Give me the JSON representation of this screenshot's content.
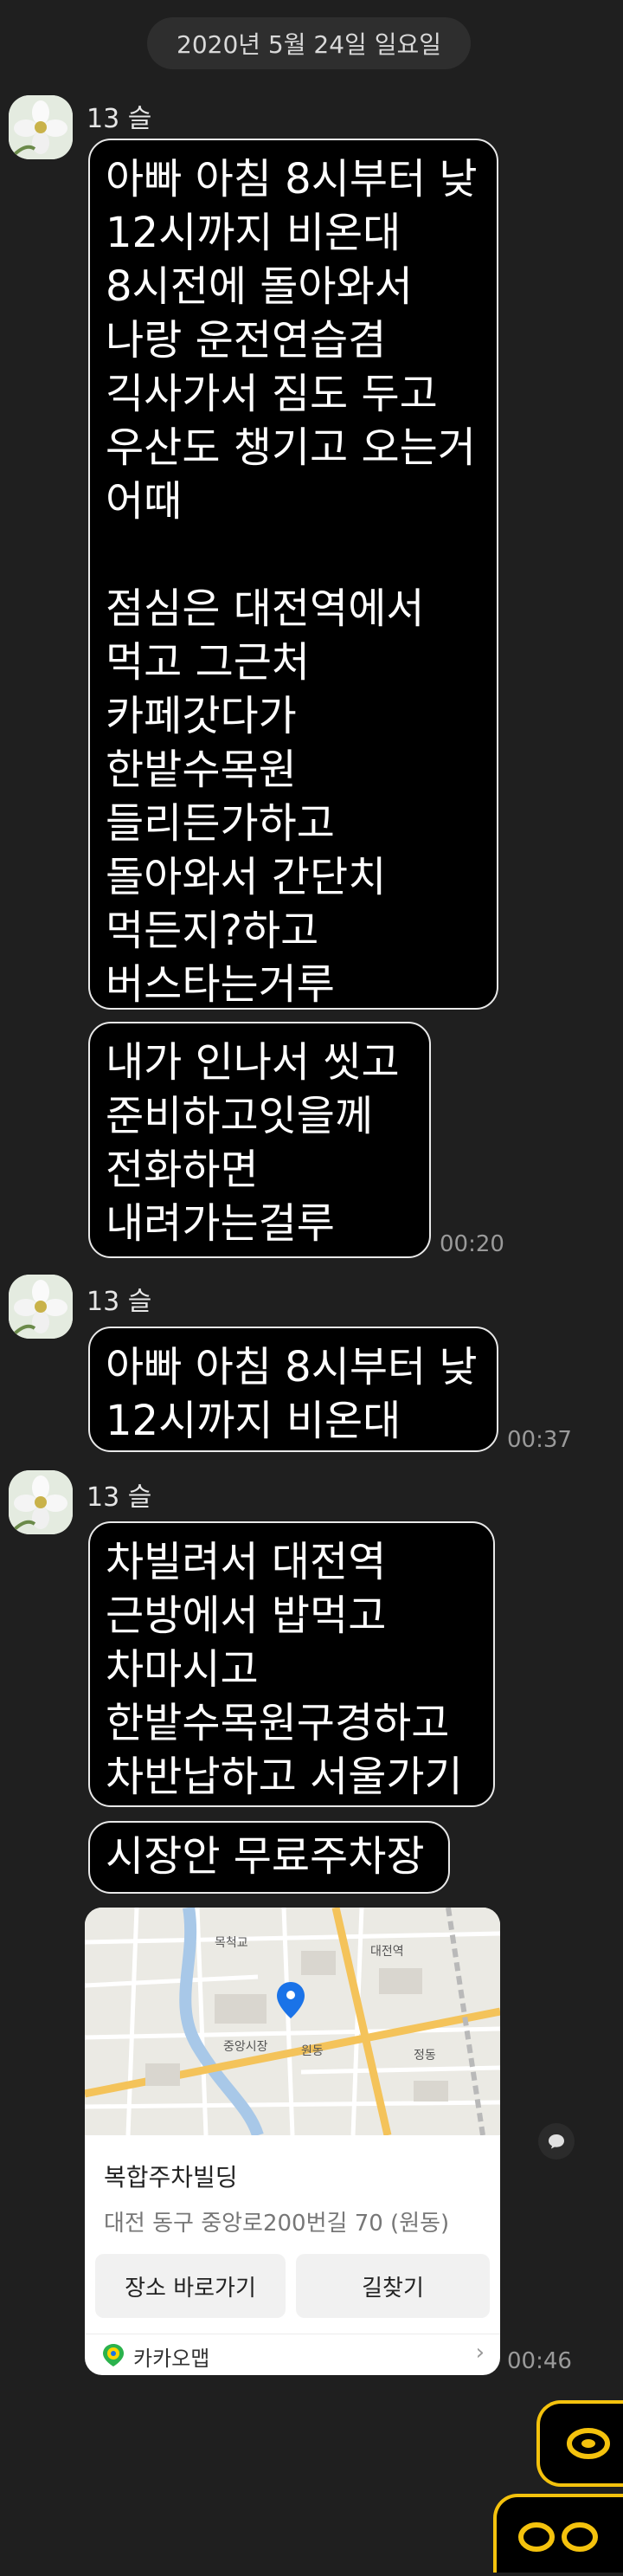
{
  "date_divider": "2020년 5월 24일 일요일",
  "sender_name": "13 슬",
  "messages": {
    "m1": "아빠 아침 8시부터 낮\n12시까지 비온대\n8시전에 돌아와서\n나랑 운전연습겸\n긱사가서 짐도 두고\n우산도 챙기고 오는거\n어때\n\n점심은 대전역에서\n먹고 그근처\n카페갓다가\n한밭수목원\n들리든가하고\n돌아와서 간단치\n먹든지?하고\n버스타는거루",
    "m2": "내가 인나서 씻고\n준비하고잇을께\n전화하면\n내려가는걸루",
    "m3": "아빠 아침 8시부터 낮\n12시까지 비온대",
    "m4": "차빌려서 대전역\n근방에서 밥먹고\n차마시고\n한밭수목원구경하고\n차반납하고 서울가기",
    "m5": "시장안 무료주차장"
  },
  "times": {
    "t1": "00:20",
    "t2": "00:37",
    "t3": "00:46"
  },
  "map_card": {
    "place_name": "복합주차빌딩",
    "address": "대전 동구 중앙로200번길 70 (원동)",
    "btn_go": "장소 바로가기",
    "btn_route": "길찾기",
    "footer_label": "카카오맵",
    "map_labels": {
      "l1": "목척교",
      "l2": "대전역",
      "l3": "중앙시장",
      "l4": "원동",
      "l5": "정동"
    }
  },
  "icons": {
    "avatar": "flower-avatar",
    "pin": "map-pin-icon",
    "kakaomap": "kakaomap-logo-icon",
    "chevron": "chevron-right-icon",
    "side": "chat-bubble-icon",
    "emoticon": "yellow-eyes-emoticon"
  },
  "colors": {
    "background": "#1f1f1f",
    "bubble": "#000000",
    "bubble_border": "#e8e8e8",
    "pin": "#1a73e8",
    "emoticon": "#f4c20d"
  }
}
